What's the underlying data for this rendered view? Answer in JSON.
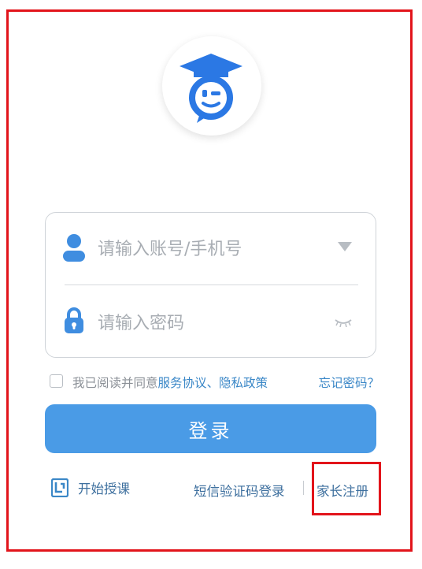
{
  "login": {
    "account_placeholder": "请输入账号/手机号",
    "password_placeholder": "请输入密码",
    "agree_prefix": "我已阅读并同意",
    "service_agreement": "服务协议",
    "separator": "、",
    "privacy_policy": "隐私政策",
    "forgot_password": "忘记密码？",
    "login_button": "登录"
  },
  "footer": {
    "start_teaching": "开始授课",
    "sms_login": "短信验证码登录",
    "parent_register": "家长注册"
  },
  "icons": {
    "logo": "graduation-cap-chat-logo-icon",
    "account": "user-icon",
    "dropdown": "triangle-down-icon",
    "password": "lock-icon",
    "visibility": "eye-closed-icon",
    "start_teaching": "teaching-app-icon"
  },
  "colors": {
    "brand_blue": "#2b78e4",
    "button_blue": "#4a9be6",
    "link_blue": "#3a87c7",
    "highlight_red": "#e2141b"
  },
  "state": {
    "agreement_checked": false
  }
}
